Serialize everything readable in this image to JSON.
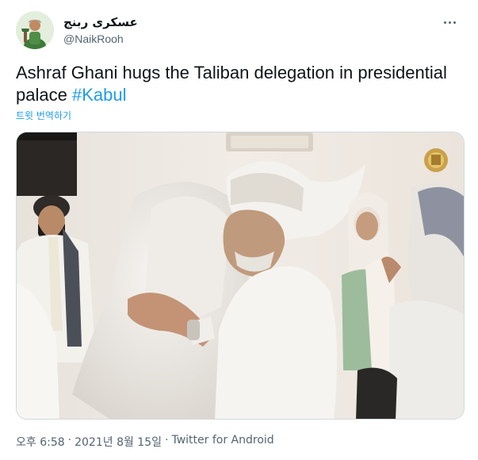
{
  "user": {
    "display_name": "عسكرى ربنج",
    "handle": "@NaikRooh",
    "avatar_icon": "avatar-icon"
  },
  "tweet": {
    "text": "Ashraf Ghani hugs the Taliban delegation in presidential palace ",
    "hashtag": "#Kabul",
    "translate_label": "트윗 번역하기"
  },
  "meta": {
    "time": "오후 6:58",
    "separator": "·",
    "date": "2021년 8월 15일",
    "source": "Twitter for Android"
  },
  "colors": {
    "link": "#1d9bf0",
    "secondary_text": "#536471"
  }
}
